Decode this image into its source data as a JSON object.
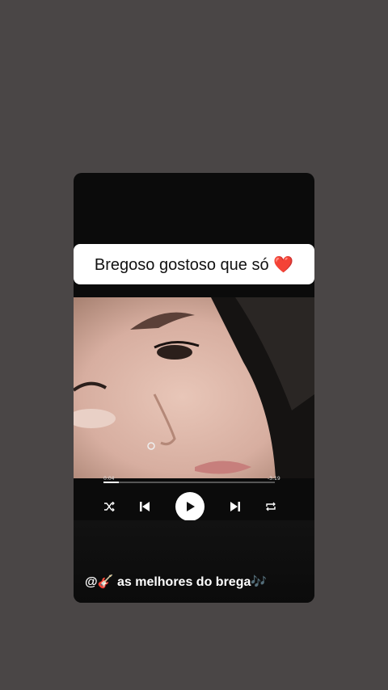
{
  "caption": "Bregoso gostoso que só ❤️",
  "player": {
    "elapsed": "0:04",
    "remaining": "-3:19",
    "progress_fraction": 0.09,
    "controls": [
      "shuffle-icon",
      "previous-icon",
      "play-icon",
      "next-icon",
      "repeat-icon"
    ]
  },
  "footer": {
    "handle": "@🎸 as melhores do brega🎶"
  }
}
